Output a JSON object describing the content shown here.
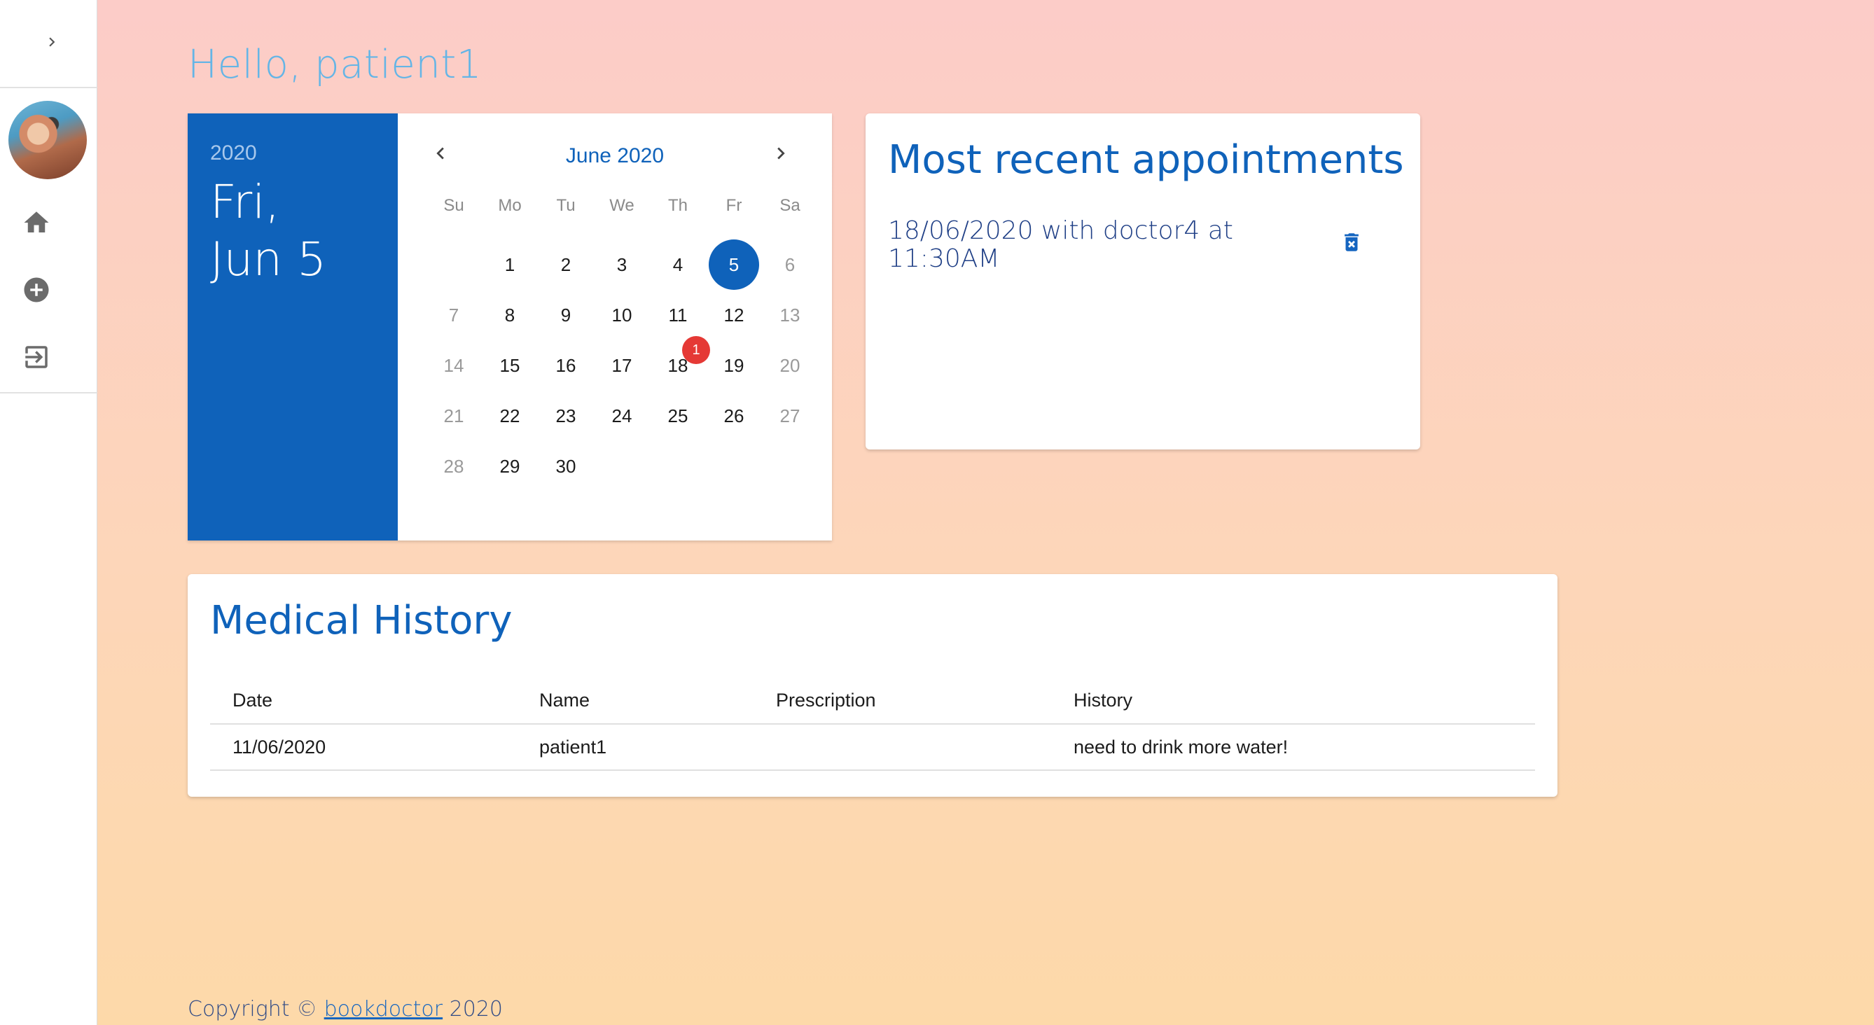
{
  "sidebar": {
    "toggle_icon": "chevron-right-icon",
    "items": [
      {
        "icon": "home-icon"
      },
      {
        "icon": "add-circle-icon"
      },
      {
        "icon": "logout-icon"
      }
    ]
  },
  "greeting": "Hello, patient1",
  "date_picker": {
    "selected_year": "2020",
    "selected_date_line1": "Fri,",
    "selected_date_line2": "Jun 5",
    "month_title": "June 2020",
    "weekdays": [
      "Su",
      "Mo",
      "Tu",
      "We",
      "Th",
      "Fr",
      "Sa"
    ],
    "weeks": [
      [
        "",
        "1",
        "2",
        "3",
        "4",
        "5",
        "6"
      ],
      [
        "7",
        "8",
        "9",
        "10",
        "11",
        "12",
        "13"
      ],
      [
        "14",
        "15",
        "16",
        "17",
        "18",
        "19",
        "20"
      ],
      [
        "21",
        "22",
        "23",
        "24",
        "25",
        "26",
        "27"
      ],
      [
        "28",
        "29",
        "30",
        "",
        "",
        "",
        ""
      ]
    ],
    "selected_day": "5",
    "badge_day": "18",
    "badge_count": "1"
  },
  "appointments": {
    "title": "Most recent appointments",
    "items": [
      {
        "text": "18/06/2020 with doctor4 at 11:30AM",
        "delete_icon": "delete-forever-icon"
      }
    ]
  },
  "medical_history": {
    "title": "Medical History",
    "columns": [
      "Date",
      "Name",
      "Prescription",
      "History"
    ],
    "rows": [
      [
        "11/06/2020",
        "patient1",
        "",
        "need to drink more water!"
      ]
    ]
  },
  "footer": {
    "prefix": "Copyright ©",
    "link_text": "bookdoctor",
    "year": "2020"
  },
  "colors": {
    "primary": "#0f62ba",
    "greeting": "#64b5e6",
    "badge": "#e53935"
  }
}
